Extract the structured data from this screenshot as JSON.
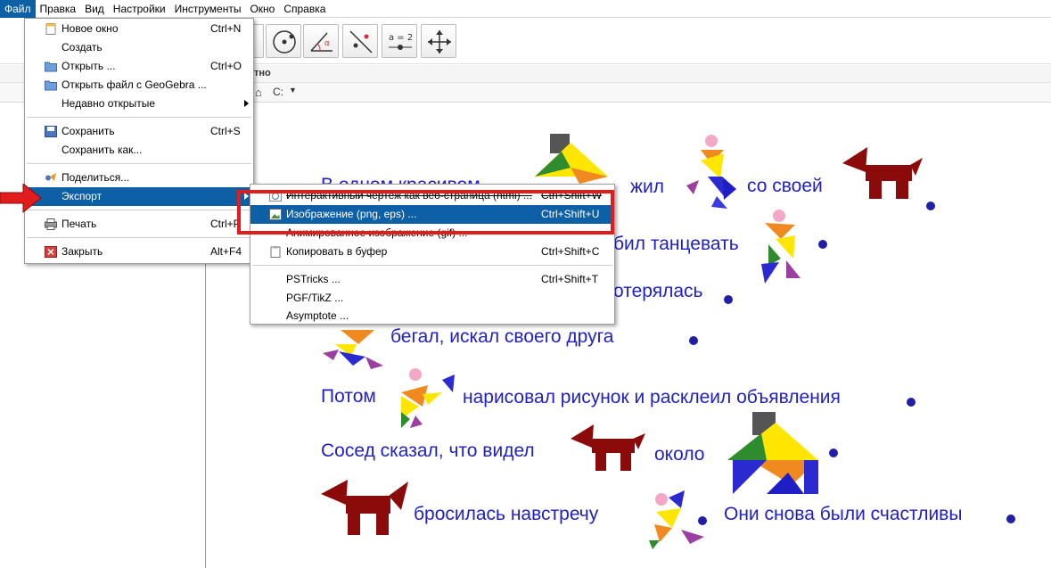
{
  "menubar": {
    "items": [
      "Файл",
      "Правка",
      "Вид",
      "Настройки",
      "Инструменты",
      "Окно",
      "Справка"
    ]
  },
  "toolbar": {
    "tools": [
      "point-tool",
      "circle-tool",
      "angle-tool",
      "reflect-tool",
      "slider-tool",
      "move-graphics-tool"
    ],
    "slider_label": "a = 2"
  },
  "subbar": {
    "text": "тно"
  },
  "pathbar": {
    "drive": "C:"
  },
  "file_menu": {
    "items": [
      {
        "label": "Новое окно",
        "shortcut": "Ctrl+N",
        "icon": "new-window-icon"
      },
      {
        "label": "Создать",
        "shortcut": "",
        "icon": ""
      },
      {
        "label": "Открыть ...",
        "shortcut": "Ctrl+O",
        "icon": "folder-icon"
      },
      {
        "label": "Открыть файл с GeoGebra ...",
        "shortcut": "",
        "icon": "folder-icon"
      },
      {
        "label": "Недавно открытые",
        "shortcut": "",
        "icon": "",
        "submenu": true
      },
      {
        "label": "Сохранить",
        "shortcut": "Ctrl+S",
        "icon": "save-icon"
      },
      {
        "label": "Сохранить как...",
        "shortcut": "",
        "icon": ""
      },
      {
        "label": "Поделиться...",
        "shortcut": "",
        "icon": "share-icon"
      },
      {
        "label": "Экспорт",
        "shortcut": "",
        "icon": "",
        "submenu": true,
        "highlighted": true
      },
      {
        "label": "Печать",
        "shortcut": "Ctrl+P",
        "icon": "print-icon"
      },
      {
        "label": "Закрыть",
        "shortcut": "Alt+F4",
        "icon": "close-icon"
      }
    ]
  },
  "export_menu": {
    "items": [
      {
        "label": "Интерактивный чертеж как веб-страница (html) ...",
        "shortcut": "Ctrl+Shift+W",
        "struck": true
      },
      {
        "label": "Изображение (png, eps) ...",
        "shortcut": "Ctrl+Shift+U",
        "highlighted": true
      },
      {
        "label": "Анимированное изображение (gif) ...",
        "shortcut": "",
        "struck": true
      },
      {
        "label": "Копировать в буфер",
        "shortcut": "Ctrl+Shift+C"
      },
      {
        "label": "PSTricks ...",
        "shortcut": "Ctrl+Shift+T"
      },
      {
        "label": "PGF/TikZ ...",
        "shortcut": ""
      },
      {
        "label": "Asymptote ...",
        "shortcut": ""
      }
    ]
  },
  "story": {
    "l1a": "В одном красивом",
    "l1b": "жил",
    "l1c": "со своей",
    "l2": "бил танцевать",
    "l3": "отерялась",
    "l4": "бегал,  искал  своего   друга",
    "l5a": "Потом",
    "l5b": "нарисовал рисунок и расклеил объявления",
    "l6a": "Сосед сказал, что видел",
    "l6b": "около",
    "l7a": "бросилась навстречу",
    "l7b": "Они снова были счастливы"
  },
  "colors": {
    "menu_highlight": "#0d5fa6",
    "story_text": "#1f1fc6",
    "annotation_red": "#e01c1c"
  }
}
